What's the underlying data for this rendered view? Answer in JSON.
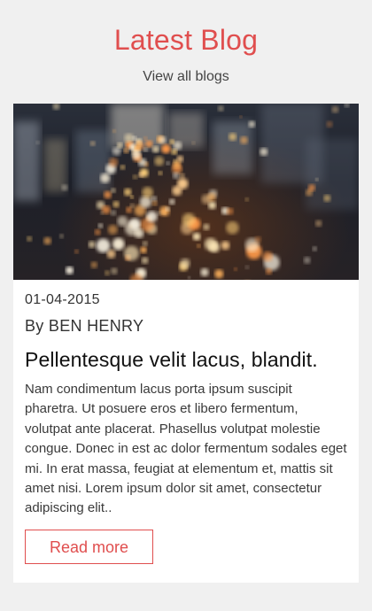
{
  "section": {
    "title": "Latest Blog",
    "view_all_label": "View all blogs"
  },
  "post": {
    "image_alt": "blurred city street lights at night",
    "date": "01-04-2015",
    "author": "By BEN HENRY",
    "title": "Pellentesque velit lacus, blandit.",
    "excerpt": "Nam condimentum lacus porta ipsum suscipit pharetra. Ut posuere eros et libero fermentum, volutpat ante placerat. Phasellus volutpat molestie congue. Donec in est ac dolor fermentum sodales eget mi. In erat massa, feugiat at elementum et, mattis sit amet nisi. Lorem ipsum dolor sit amet, consectetur adipiscing elit..",
    "read_more_label": "Read more"
  },
  "colors": {
    "accent": "#e04e4e",
    "background": "#f0f0f0",
    "card": "#ffffff"
  }
}
